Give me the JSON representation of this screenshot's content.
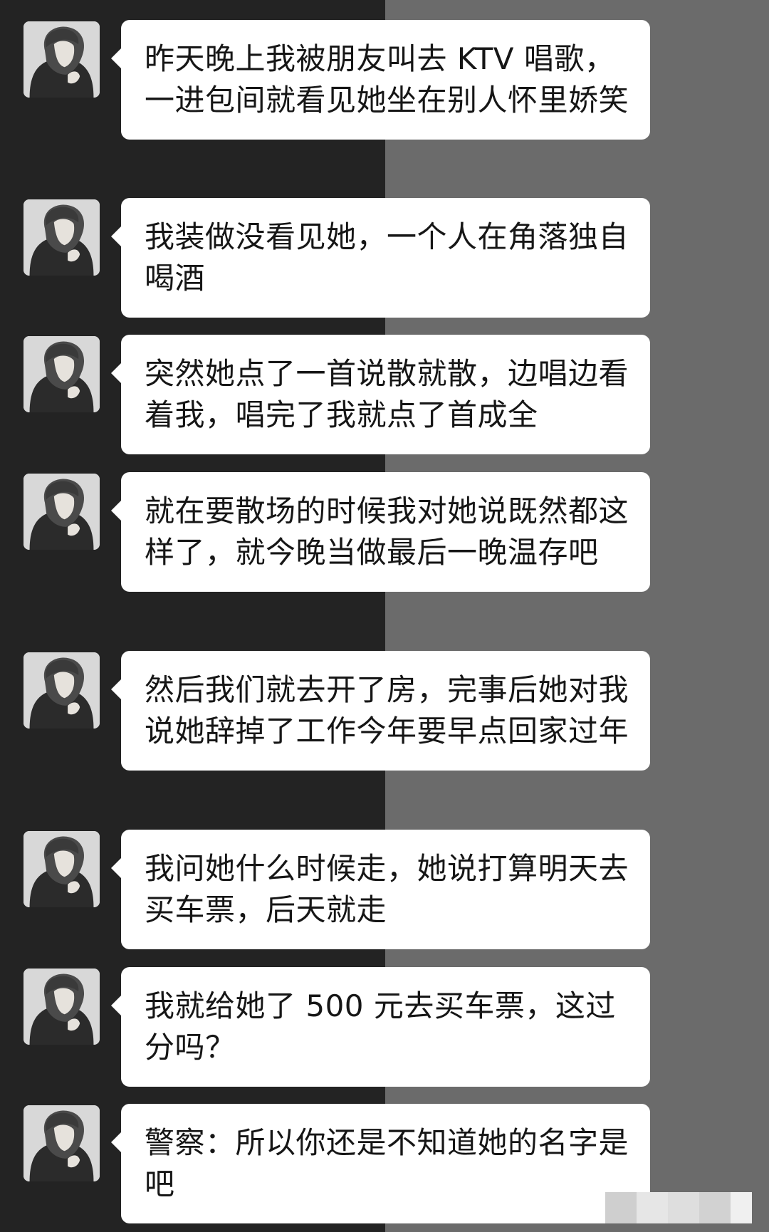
{
  "chat": {
    "messages": [
      {
        "text": "昨天晚上我被朋友叫去 KTV 唱歌，一进包间就看见她坐在别人怀里娇笑",
        "avatar_icon": "anime-boy-avatar-icon"
      },
      {
        "text": "我装做没看见她，一个人在角落独自喝酒",
        "avatar_icon": "anime-boy-avatar-icon"
      },
      {
        "text": "突然她点了一首说散就散，边唱边看着我，唱完了我就点了首成全",
        "avatar_icon": "anime-boy-avatar-icon"
      },
      {
        "text": "就在要散场的时候我对她说既然都这样了，就今晚当做最后一晚温存吧",
        "avatar_icon": "anime-boy-avatar-icon"
      },
      {
        "text": "然后我们就去开了房，完事后她对我说她辞掉了工作今年要早点回家过年",
        "avatar_icon": "anime-boy-avatar-icon"
      },
      {
        "text": "我问她什么时候走，她说打算明天去买车票，后天就走",
        "avatar_icon": "anime-boy-avatar-icon"
      },
      {
        "text": "我就给她了 500 元去买车票，这过分吗？",
        "avatar_icon": "anime-boy-avatar-icon"
      },
      {
        "text": "警察：所以你还是不知道她的名字是吧",
        "avatar_icon": "anime-boy-avatar-icon"
      }
    ]
  },
  "colors": {
    "background_left": "#232323",
    "background_right": "#6b6b6b",
    "bubble": "#ffffff",
    "text": "#161616"
  }
}
